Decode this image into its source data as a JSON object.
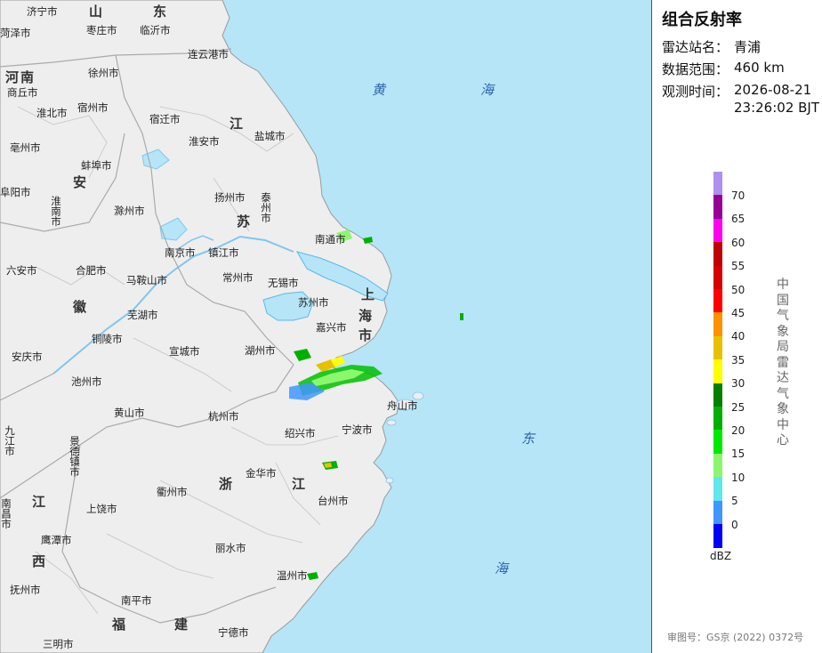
{
  "panel": {
    "title": "组合反射率",
    "station_label": "雷达站名：",
    "station_value": "青浦",
    "range_label": "数据范围：",
    "range_value": "460 km",
    "time_label": "观测时间：",
    "time_date": "2026-08-21",
    "time_clock": "23:26:02 BJT",
    "legend_unit": "dBZ",
    "issuer": "中国气象局雷达气象中心",
    "approval": "审图号：GS京 (2022) 0372号"
  },
  "legend": {
    "labels": [
      "70",
      "65",
      "60",
      "55",
      "50",
      "45",
      "40",
      "35",
      "30",
      "25",
      "20",
      "15",
      "10",
      "5",
      "0"
    ],
    "colors": [
      "#ad90f0",
      "#960096",
      "#ff00f0",
      "#c00000",
      "#d60000",
      "#ff0000",
      "#ff9000",
      "#e7c000",
      "#ffff00",
      "#008000",
      "#00b000",
      "#00ea00",
      "#8cf76e",
      "#01a0f6",
      "#0000f6",
      "#60e6ec",
      "#3f97ff"
    ]
  },
  "map": {
    "water_color": "#b6e5f8",
    "land_color": "#eeeeee",
    "provinces": [
      {
        "text": "山"
      },
      {
        "text": "东"
      },
      {
        "text": "河南"
      },
      {
        "text": "江"
      },
      {
        "text": "安"
      },
      {
        "text": "苏"
      },
      {
        "text": "徽"
      },
      {
        "text": "上"
      },
      {
        "text": "海"
      },
      {
        "text": "市"
      },
      {
        "text": "浙"
      },
      {
        "text": "江"
      },
      {
        "text": "江"
      },
      {
        "text": "西"
      },
      {
        "text": "福"
      },
      {
        "text": "建"
      }
    ],
    "seas": [
      {
        "text": "黄"
      },
      {
        "text": "海"
      },
      {
        "text": "东"
      },
      {
        "text": "海"
      }
    ],
    "cities": [
      "济宁市",
      "临沂市",
      "枣庄市",
      "菏泽市",
      "连云港市",
      "徐州市",
      "商丘市",
      "淮北市",
      "宿州市",
      "宿迁市",
      "亳州市",
      "淮安市",
      "盐城市",
      "蚌埠市",
      "阜阳市",
      "淮南市",
      "滁州市",
      "扬州市",
      "泰州市",
      "南通市",
      "六安市",
      "合肥市",
      "南京市",
      "镇江市",
      "常州市",
      "马鞍山市",
      "无锡市",
      "苏州市",
      "芜湖市",
      "铜陵市",
      "安庆市",
      "湖州市",
      "宣城市",
      "池州市",
      "嘉兴市",
      "黄山市",
      "杭州市",
      "舟山市",
      "绍兴市",
      "宁波市",
      "九江市",
      "景德镇市",
      "金华市",
      "衢州市",
      "台州市",
      "上饶市",
      "南昌市",
      "鹰潭市",
      "丽水市",
      "温州市",
      "抚州市",
      "南平市",
      "宁德市",
      "三明市"
    ]
  }
}
